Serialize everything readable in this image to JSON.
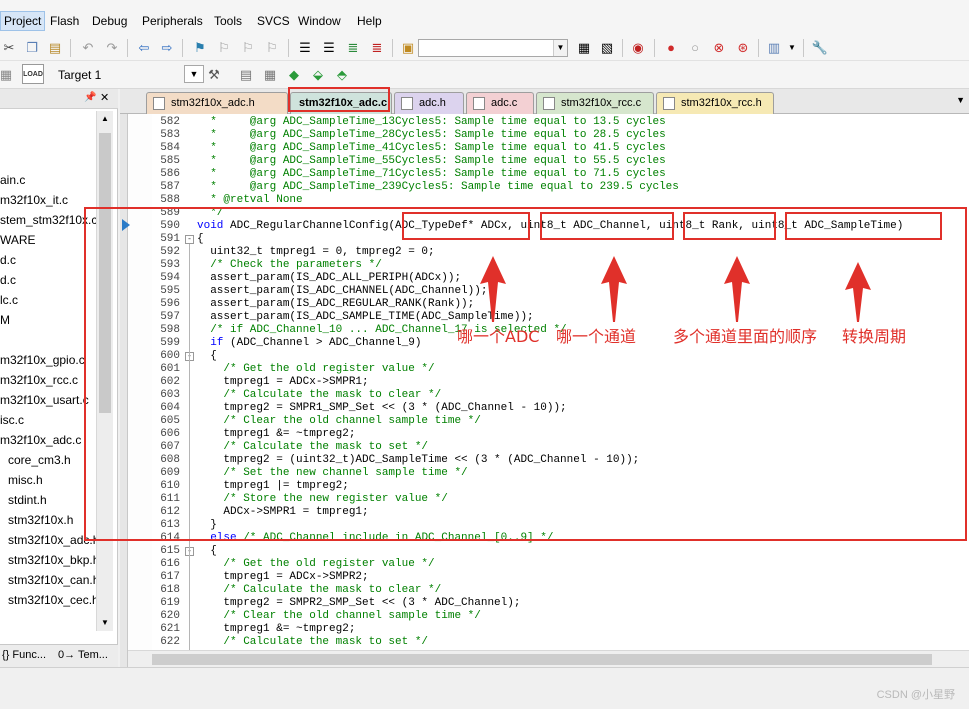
{
  "menu": [
    "Project",
    "Flash",
    "Debug",
    "Peripherals",
    "Tools",
    "SVCS",
    "Window",
    "Help"
  ],
  "toolbar2": {
    "target_label": "Target 1",
    "load_label": "LOAD"
  },
  "project_panel": {
    "items": [
      "ain.c",
      "m32f10x_it.c",
      "stem_stm32f10x.c",
      "WARE",
      "d.c",
      "d.c",
      "lc.c",
      "M",
      "",
      "m32f10x_gpio.c",
      "m32f10x_rcc.c",
      "m32f10x_usart.c",
      "isc.c",
      "m32f10x_adc.c",
      "core_cm3.h",
      "misc.h",
      "stdint.h",
      "stm32f10x.h",
      "stm32f10x_adc.h",
      "stm32f10x_bkp.h",
      "stm32f10x_can.h",
      "stm32f10x_cec.h"
    ],
    "tabs": [
      "{} Func...",
      "0→ Tem..."
    ]
  },
  "editor_tabs": [
    {
      "label": "stm32f10x_adc.h",
      "color": "#f3dcc6"
    },
    {
      "label": "stm32f10x_adc.c",
      "color": "#cfe3dc"
    },
    {
      "label": "adc.h",
      "color": "#dcd3ee"
    },
    {
      "label": "adc.c",
      "color": "#f3d0d3"
    },
    {
      "label": "stm32f10x_rcc.c",
      "color": "#d6e6cd"
    },
    {
      "label": "stm32f10x_rcc.h",
      "color": "#f6e9b4"
    }
  ],
  "code_lines": [
    {
      "n": "582",
      "segs": [
        {
          "t": "  *     @arg ADC_SampleTime_13Cycles5: Sample time equal to 13.5 cycles",
          "c": "cmt"
        }
      ]
    },
    {
      "n": "583",
      "segs": [
        {
          "t": "  *     @arg ADC_SampleTime_28Cycles5: Sample time equal to 28.5 cycles",
          "c": "cmt"
        }
      ]
    },
    {
      "n": "584",
      "segs": [
        {
          "t": "  *     @arg ADC_SampleTime_41Cycles5: Sample time equal to 41.5 cycles",
          "c": "cmt"
        }
      ]
    },
    {
      "n": "585",
      "segs": [
        {
          "t": "  *     @arg ADC_SampleTime_55Cycles5: Sample time equal to 55.5 cycles",
          "c": "cmt"
        }
      ]
    },
    {
      "n": "586",
      "segs": [
        {
          "t": "  *     @arg ADC_SampleTime_71Cycles5: Sample time equal to 71.5 cycles",
          "c": "cmt"
        }
      ]
    },
    {
      "n": "587",
      "segs": [
        {
          "t": "  *     @arg ADC_SampleTime_239Cycles5: Sample time equal to 239.5 cycles",
          "c": "cmt"
        }
      ]
    },
    {
      "n": "588",
      "segs": [
        {
          "t": "  * @retval None",
          "c": "cmt"
        }
      ]
    },
    {
      "n": "589",
      "segs": [
        {
          "t": "  */",
          "c": "cmt"
        }
      ]
    },
    {
      "n": "590",
      "segs": [
        {
          "t": "void ",
          "c": "kw"
        },
        {
          "t": "ADC_RegularChannelConfig",
          "c": "sel"
        },
        {
          "t": "(ADC_TypeDef* ADCx, uint8_t ADC_Channel, uint8_t Rank, uint8_t ADC_SampleTime)",
          "c": "plain"
        }
      ]
    },
    {
      "n": "591",
      "segs": [
        {
          "t": "{",
          "c": "plain"
        }
      ],
      "fold": "-"
    },
    {
      "n": "592",
      "segs": [
        {
          "t": "  uint32_t tmpreg1 = 0, tmpreg2 = 0;",
          "c": "plain"
        }
      ]
    },
    {
      "n": "593",
      "segs": [
        {
          "t": "  /* Check the parameters */",
          "c": "cmt"
        }
      ]
    },
    {
      "n": "594",
      "segs": [
        {
          "t": "  assert_param(IS_ADC_ALL_PERIPH(ADCx));",
          "c": "plain"
        }
      ]
    },
    {
      "n": "595",
      "segs": [
        {
          "t": "  assert_param(IS_ADC_CHANNEL(ADC_Channel));",
          "c": "plain"
        }
      ]
    },
    {
      "n": "596",
      "segs": [
        {
          "t": "  assert_param(IS_ADC_REGULAR_RANK(Rank));",
          "c": "plain"
        }
      ]
    },
    {
      "n": "597",
      "segs": [
        {
          "t": "  assert_param(IS_ADC_SAMPLE_TIME(ADC_SampleTime));",
          "c": "plain"
        }
      ]
    },
    {
      "n": "598",
      "segs": [
        {
          "t": "  /* if ADC_Channel_10 ... ADC_Channel_17 is selected */",
          "c": "cmt"
        }
      ]
    },
    {
      "n": "599",
      "segs": [
        {
          "t": "  if",
          "c": "kw"
        },
        {
          "t": " (ADC_Channel > ADC_Channel_9)",
          "c": "plain"
        }
      ]
    },
    {
      "n": "600",
      "segs": [
        {
          "t": "  {",
          "c": "plain"
        }
      ],
      "fold": "-"
    },
    {
      "n": "601",
      "segs": [
        {
          "t": "    /* Get the old register value */",
          "c": "cmt"
        }
      ]
    },
    {
      "n": "602",
      "segs": [
        {
          "t": "    tmpreg1 = ADCx->SMPR1;",
          "c": "plain"
        }
      ]
    },
    {
      "n": "603",
      "segs": [
        {
          "t": "    /* Calculate the mask to clear */",
          "c": "cmt"
        }
      ]
    },
    {
      "n": "604",
      "segs": [
        {
          "t": "    tmpreg2 = SMPR1_SMP_Set << (3 * (ADC_Channel - 10));",
          "c": "plain"
        }
      ]
    },
    {
      "n": "605",
      "segs": [
        {
          "t": "    /* Clear the old channel sample time */",
          "c": "cmt"
        }
      ]
    },
    {
      "n": "606",
      "segs": [
        {
          "t": "    tmpreg1 &= ~tmpreg2;",
          "c": "plain"
        }
      ]
    },
    {
      "n": "607",
      "segs": [
        {
          "t": "    /* Calculate the mask to set */",
          "c": "cmt"
        }
      ]
    },
    {
      "n": "608",
      "segs": [
        {
          "t": "    tmpreg2 = (uint32_t)ADC_SampleTime << (3 * (ADC_Channel - 10));",
          "c": "plain"
        }
      ]
    },
    {
      "n": "609",
      "segs": [
        {
          "t": "    /* Set the new channel sample time */",
          "c": "cmt"
        }
      ]
    },
    {
      "n": "610",
      "segs": [
        {
          "t": "    tmpreg1 |= tmpreg2;",
          "c": "plain"
        }
      ]
    },
    {
      "n": "611",
      "segs": [
        {
          "t": "    /* Store the new register value */",
          "c": "cmt"
        }
      ]
    },
    {
      "n": "612",
      "segs": [
        {
          "t": "    ADCx->SMPR1 = tmpreg1;",
          "c": "plain"
        }
      ]
    },
    {
      "n": "613",
      "segs": [
        {
          "t": "  }",
          "c": "plain"
        }
      ]
    },
    {
      "n": "614",
      "segs": [
        {
          "t": "  else",
          "c": "kw"
        },
        {
          "t": " /* ADC_Channel include in ADC_Channel_[0..9] */",
          "c": "cmt"
        }
      ]
    },
    {
      "n": "615",
      "segs": [
        {
          "t": "  {",
          "c": "plain"
        }
      ],
      "fold": "-"
    },
    {
      "n": "616",
      "segs": [
        {
          "t": "    /* Get the old register value */",
          "c": "cmt"
        }
      ]
    },
    {
      "n": "617",
      "segs": [
        {
          "t": "    tmpreg1 = ADCx->SMPR2;",
          "c": "plain"
        }
      ]
    },
    {
      "n": "618",
      "segs": [
        {
          "t": "    /* Calculate the mask to clear */",
          "c": "cmt"
        }
      ]
    },
    {
      "n": "619",
      "segs": [
        {
          "t": "    tmpreg2 = SMPR2_SMP_Set << (3 * ADC_Channel);",
          "c": "plain"
        }
      ]
    },
    {
      "n": "620",
      "segs": [
        {
          "t": "    /* Clear the old channel sample time */",
          "c": "cmt"
        }
      ]
    },
    {
      "n": "621",
      "segs": [
        {
          "t": "    tmpreg1 &= ~tmpreg2;",
          "c": "plain"
        }
      ]
    },
    {
      "n": "622",
      "segs": [
        {
          "t": "    /* Calculate the mask to set */",
          "c": "cmt"
        }
      ]
    }
  ],
  "annotations": [
    "哪一个ADC",
    "哪一个通道",
    "多个通道里面的顺序",
    "转换周期"
  ],
  "annotation_color": "#e0302a",
  "watermark": "CSDN @小星野"
}
